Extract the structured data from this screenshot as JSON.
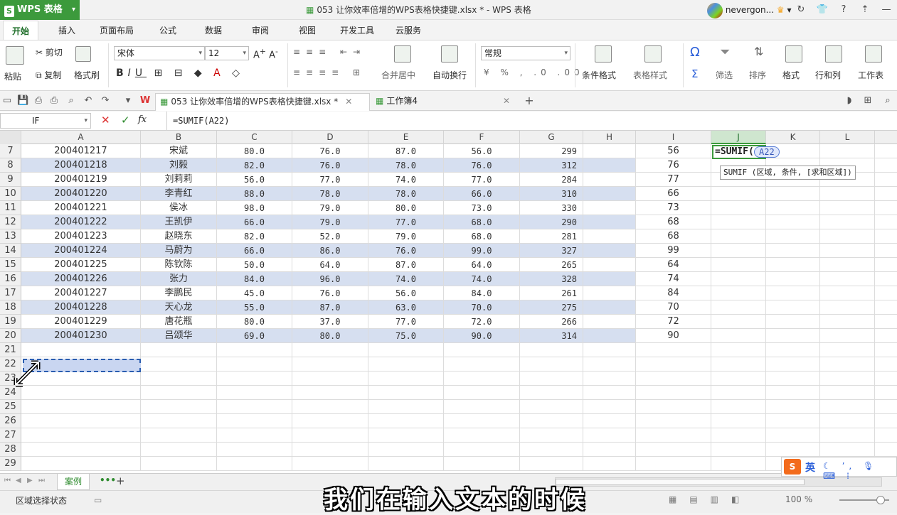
{
  "app": {
    "logo": "WPS 表格",
    "window_title": "053 让你效率倍增的WPS表格快捷键.xlsx * - WPS 表格",
    "user": "nevergon..."
  },
  "menu_tabs": [
    "开始",
    "插入",
    "页面布局",
    "公式",
    "数据",
    "审阅",
    "视图",
    "开发工具",
    "云服务"
  ],
  "ribbon": {
    "paste": "粘贴",
    "cut": "剪切",
    "copy": "复制",
    "format_painter": "格式刷",
    "font_name": "宋体",
    "font_size": "12",
    "merge_center": "合并居中",
    "wrap_text": "自动换行",
    "number_format": "常规",
    "cond_format": "条件格式",
    "table_style": "表格样式",
    "symbol": "Ω",
    "sum": "Σ",
    "filter": "筛选",
    "sort": "排序",
    "format": "格式",
    "rows_cols": "行和列",
    "worksheet": "工作表"
  },
  "doc_tabs": [
    {
      "label": "053 让你效率倍增的WPS表格快捷键.xlsx *",
      "active": true
    },
    {
      "label": "工作簿4",
      "active": false
    }
  ],
  "formula_bar": {
    "name_box": "IF",
    "formula": "=SUMIF(A22)"
  },
  "columns": [
    "A",
    "B",
    "C",
    "D",
    "E",
    "F",
    "G",
    "H",
    "I",
    "J",
    "K",
    "L"
  ],
  "rows": [
    {
      "n": "7",
      "id": "200401217",
      "name": "宋斌",
      "c": "80.0",
      "d": "76.0",
      "e": "87.0",
      "f": "56.0",
      "g": "299",
      "i": "56"
    },
    {
      "n": "8",
      "id": "200401218",
      "name": "刘毅",
      "c": "82.0",
      "d": "76.0",
      "e": "78.0",
      "f": "76.0",
      "g": "312",
      "i": "76"
    },
    {
      "n": "9",
      "id": "200401219",
      "name": "刘莉莉",
      "c": "56.0",
      "d": "77.0",
      "e": "74.0",
      "f": "77.0",
      "g": "284",
      "i": "77"
    },
    {
      "n": "10",
      "id": "200401220",
      "name": "李青红",
      "c": "88.0",
      "d": "78.0",
      "e": "78.0",
      "f": "66.0",
      "g": "310",
      "i": "66"
    },
    {
      "n": "11",
      "id": "200401221",
      "name": "侯冰",
      "c": "98.0",
      "d": "79.0",
      "e": "80.0",
      "f": "73.0",
      "g": "330",
      "i": "73"
    },
    {
      "n": "12",
      "id": "200401222",
      "name": "王凯伊",
      "c": "66.0",
      "d": "79.0",
      "e": "77.0",
      "f": "68.0",
      "g": "290",
      "i": "68"
    },
    {
      "n": "13",
      "id": "200401223",
      "name": "赵晓东",
      "c": "82.0",
      "d": "52.0",
      "e": "79.0",
      "f": "68.0",
      "g": "281",
      "i": "68"
    },
    {
      "n": "14",
      "id": "200401224",
      "name": "马蔚为",
      "c": "66.0",
      "d": "86.0",
      "e": "76.0",
      "f": "99.0",
      "g": "327",
      "i": "99"
    },
    {
      "n": "15",
      "id": "200401225",
      "name": "陈钦陈",
      "c": "50.0",
      "d": "64.0",
      "e": "87.0",
      "f": "64.0",
      "g": "265",
      "i": "64"
    },
    {
      "n": "16",
      "id": "200401226",
      "name": "张力",
      "c": "84.0",
      "d": "96.0",
      "e": "74.0",
      "f": "74.0",
      "g": "328",
      "i": "74"
    },
    {
      "n": "17",
      "id": "200401227",
      "name": "李鹏民",
      "c": "45.0",
      "d": "76.0",
      "e": "56.0",
      "f": "84.0",
      "g": "261",
      "i": "84"
    },
    {
      "n": "18",
      "id": "200401228",
      "name": "天心龙",
      "c": "55.0",
      "d": "87.0",
      "e": "63.0",
      "f": "70.0",
      "g": "275",
      "i": "70"
    },
    {
      "n": "19",
      "id": "200401229",
      "name": "唐花瓶",
      "c": "80.0",
      "d": "37.0",
      "e": "77.0",
      "f": "72.0",
      "g": "266",
      "i": "72"
    },
    {
      "n": "20",
      "id": "200401230",
      "name": "吕颂华",
      "c": "69.0",
      "d": "80.0",
      "e": "75.0",
      "f": "90.0",
      "g": "314",
      "i": "90"
    }
  ],
  "empty_rows": [
    "21",
    "22",
    "23",
    "24",
    "25",
    "26",
    "27",
    "28",
    "29"
  ],
  "active_cell": {
    "text": "=SUMIF(",
    "ref_chip": "A22"
  },
  "tooltip": "SUMIF (区域, 条件, [求和区域])",
  "sheet_tabs": {
    "active": "案例",
    "more": "•••",
    "add": "+"
  },
  "status": {
    "text": "区域选择状态",
    "zoom": "100 %"
  },
  "ime": {
    "logo": "S",
    "mode": "英",
    "icons": "☾ ʼ, 🎙 ⌨ ⁞"
  },
  "subtitle": "我们在输入文本的时候",
  "colors": {
    "accent": "#3c9a3c",
    "band": "#d6dff0",
    "ref": "#3556b8"
  }
}
